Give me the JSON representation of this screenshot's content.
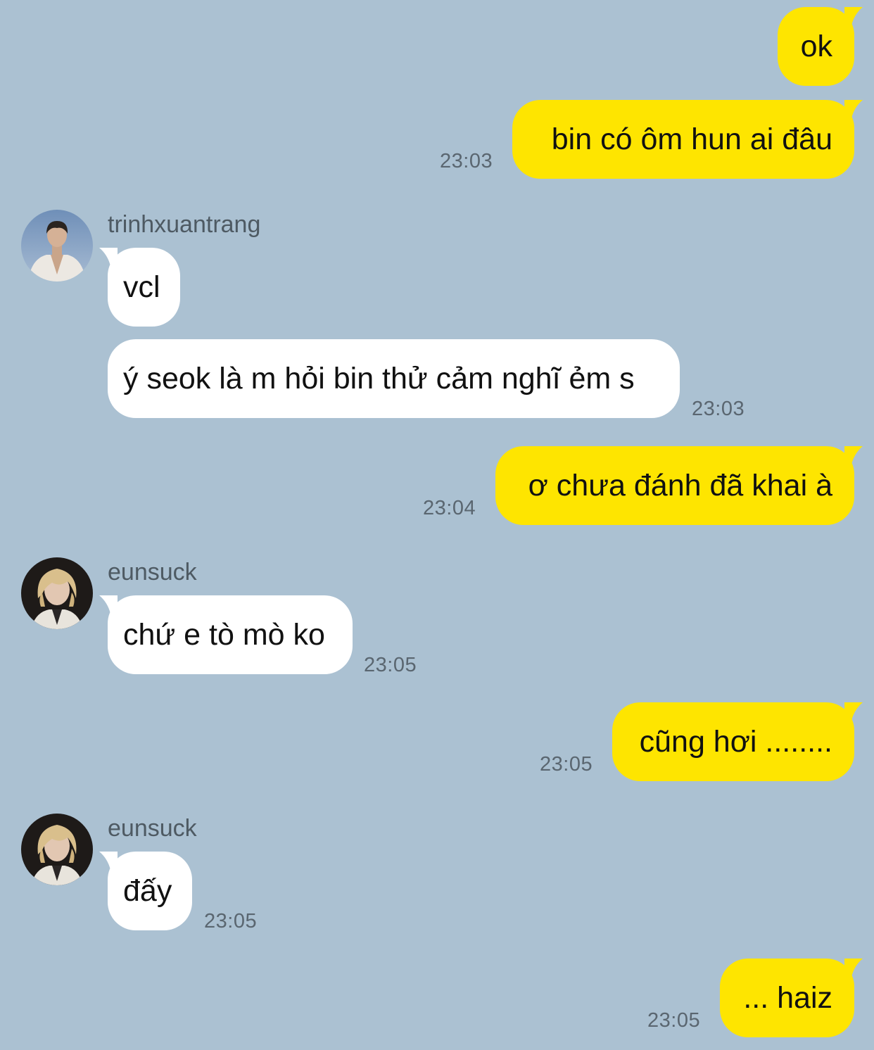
{
  "messages": [
    {
      "direction": "out",
      "text": "ok",
      "time": ""
    },
    {
      "direction": "out",
      "text": "bin có ôm hun ai đâu",
      "time": "23:03"
    },
    {
      "direction": "in",
      "sender": "trinhxuantrang",
      "avatar": "avatar-trinhxuantrang",
      "text": "vcl",
      "time": ""
    },
    {
      "direction": "in",
      "text": "ý seok là m hỏi bin thử cảm nghĩ ẻm s",
      "time": "23:03"
    },
    {
      "direction": "out",
      "text": "ơ chưa đánh đã khai à",
      "time": "23:04"
    },
    {
      "direction": "in",
      "sender": "eunsuck",
      "avatar": "avatar-eunsuck",
      "text": "chứ e tò mò ko",
      "time": "23:05"
    },
    {
      "direction": "out",
      "text": "cũng hơi ........",
      "time": "23:05"
    },
    {
      "direction": "in",
      "sender": "eunsuck",
      "avatar": "avatar-eunsuck",
      "text": "đấy",
      "time": "23:05"
    },
    {
      "direction": "out",
      "text": "... haiz",
      "time": "23:05"
    }
  ],
  "colors": {
    "background": "#abc1d2",
    "outgoing_bubble": "#fee500",
    "incoming_bubble": "#ffffff",
    "timestamp": "#5a6670",
    "sender_name": "#4e5a63"
  }
}
